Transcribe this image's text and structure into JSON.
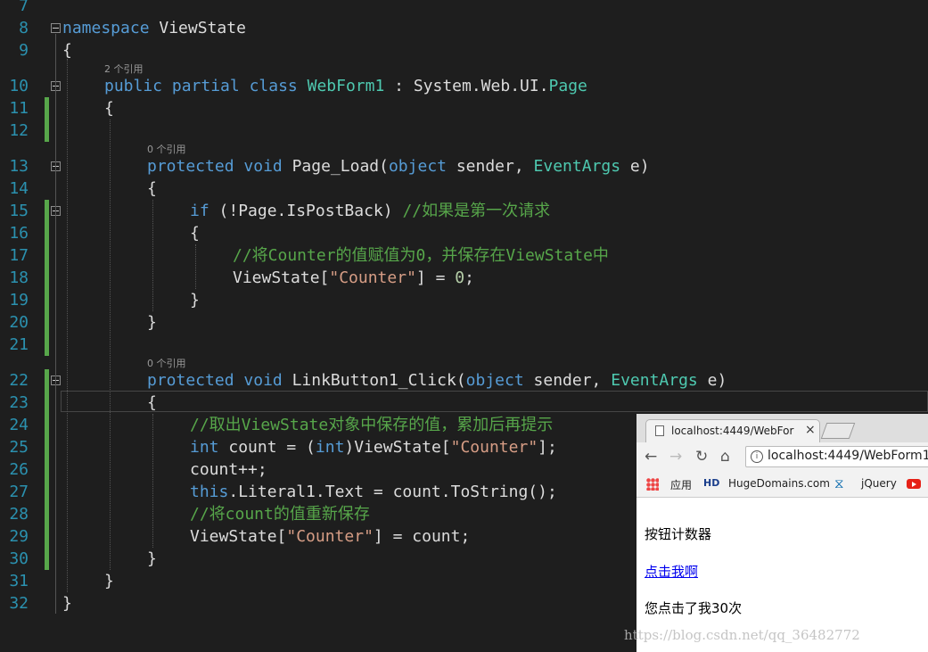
{
  "editor": {
    "line_numbers": [
      "7",
      "8",
      "9",
      "10",
      "11",
      "12",
      "13",
      "14",
      "15",
      "16",
      "17",
      "18",
      "19",
      "20",
      "21",
      "22",
      "23",
      "24",
      "25",
      "26",
      "27",
      "28",
      "29",
      "30",
      "31",
      "32"
    ],
    "codelens": {
      "class_refs": "2 个引用",
      "page_load_refs": "0 个引用",
      "click_refs": "0 个引用"
    },
    "lines": {
      "l8": {
        "kw": "namespace",
        "rest": " ViewState"
      },
      "l9": "{",
      "l10": {
        "kw1": "public",
        "kw2": "partial",
        "kw3": "class",
        "name": "WebForm1",
        "sep": " : System.Web.UI.",
        "type": "Page"
      },
      "l11": "{",
      "l13": {
        "kw1": "protected",
        "kw2": "void",
        "name": " Page_Load(",
        "kw3": "object",
        "p1": " sender, ",
        "type": "EventArgs",
        "p2": " e)"
      },
      "l14": "{",
      "l15": {
        "kw": "if",
        "cond": " (!Page.IsPostBack) ",
        "comment": "//如果是第一次请求"
      },
      "l16": "{",
      "l17": "//将Counter的值赋值为0，并保存在ViewState中",
      "l18": {
        "pre": "ViewState[",
        "str": "\"Counter\"",
        "mid": "] = ",
        "num": "0",
        "end": ";"
      },
      "l19": "}",
      "l20": "}",
      "l22": {
        "kw1": "protected",
        "kw2": "void",
        "name": " LinkButton1_Click(",
        "kw3": "object",
        "p1": " sender, ",
        "type": "EventArgs",
        "p2": " e)"
      },
      "l23": "{",
      "l24": "//取出ViewState对象中保存的值，累加后再提示",
      "l25": {
        "kw1": "int",
        "a": " count = (",
        "kw2": "int",
        "b": ")ViewState[",
        "str": "\"Counter\"",
        "c": "];"
      },
      "l26": "count++;",
      "l27": {
        "kw": "this",
        "rest": ".Literal1.Text = count.ToString();"
      },
      "l28": "//将count的值重新保存",
      "l29": {
        "pre": "ViewState[",
        "str": "\"Counter\"",
        "end": "] = count;"
      },
      "l30": "}",
      "l31": "}",
      "l32": "}"
    }
  },
  "browser": {
    "tab_title": "localhost:4449/WebFor",
    "tab_close": "×",
    "url": "localhost:4449/WebForm1.",
    "bookmarks": {
      "apps": "应用",
      "hd_icon_text": "HD",
      "hugedomains": "HugeDomains.com",
      "jquery": "jQuery"
    },
    "page": {
      "heading": "按钮计数器",
      "link": "点击我啊",
      "result": "您点击了我30次"
    }
  },
  "watermark": "https://blog.csdn.net/qq_36482772",
  "colors": {
    "background": "#1e1e1e",
    "keyword": "#569cd6",
    "type": "#4ec9b0",
    "string": "#d69d85",
    "comment": "#57a64a",
    "line_number": "#2b91af"
  }
}
